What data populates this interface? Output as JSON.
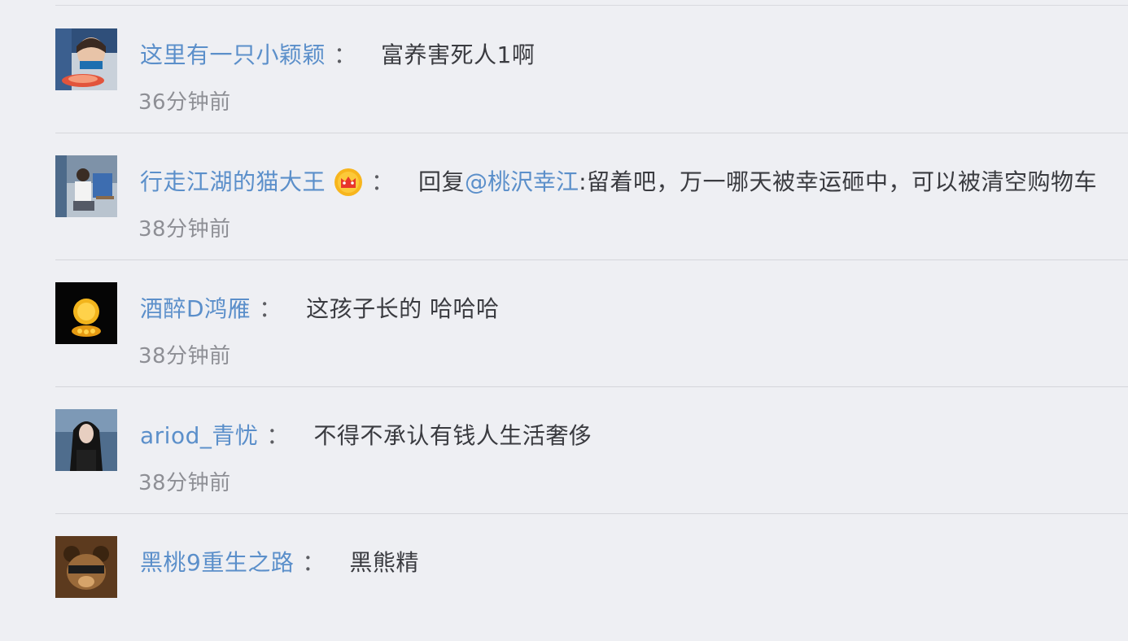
{
  "comments": [
    {
      "username": "这里有一只小颖颖",
      "colon": "：",
      "content": "富养害死人1啊",
      "time": "36分钟前",
      "avatar_icon": "girl-with-food-avatar"
    },
    {
      "username": "行走江湖的猫大王",
      "badge_icon": "crown-badge-icon",
      "colon": "：",
      "reply_prefix": "回复",
      "mention": "@桃沢幸江",
      "content": ":留着吧，万一哪天被幸运砸中，可以被清空购物车",
      "time": "38分钟前",
      "avatar_icon": "person-at-desk-avatar"
    },
    {
      "username": "酒醉D鸿雁",
      "colon": "：",
      "content": "这孩子长的 哈哈哈",
      "time": "38分钟前",
      "avatar_icon": "yellow-glow-avatar"
    },
    {
      "username": "ariod_青忧",
      "colon": "：",
      "content": "不得不承认有钱人生活奢侈",
      "time": "38分钟前",
      "avatar_icon": "long-hair-woman-avatar"
    },
    {
      "username": "黑桃9重生之路",
      "colon": "：",
      "content": "黑熊精",
      "time": "",
      "avatar_icon": "bear-avatar"
    }
  ],
  "colors": {
    "background": "#eeeff3",
    "username": "#5b8fca",
    "content": "#3a3b40",
    "timestamp": "#8e8f95",
    "divider": "#d5d6db"
  }
}
